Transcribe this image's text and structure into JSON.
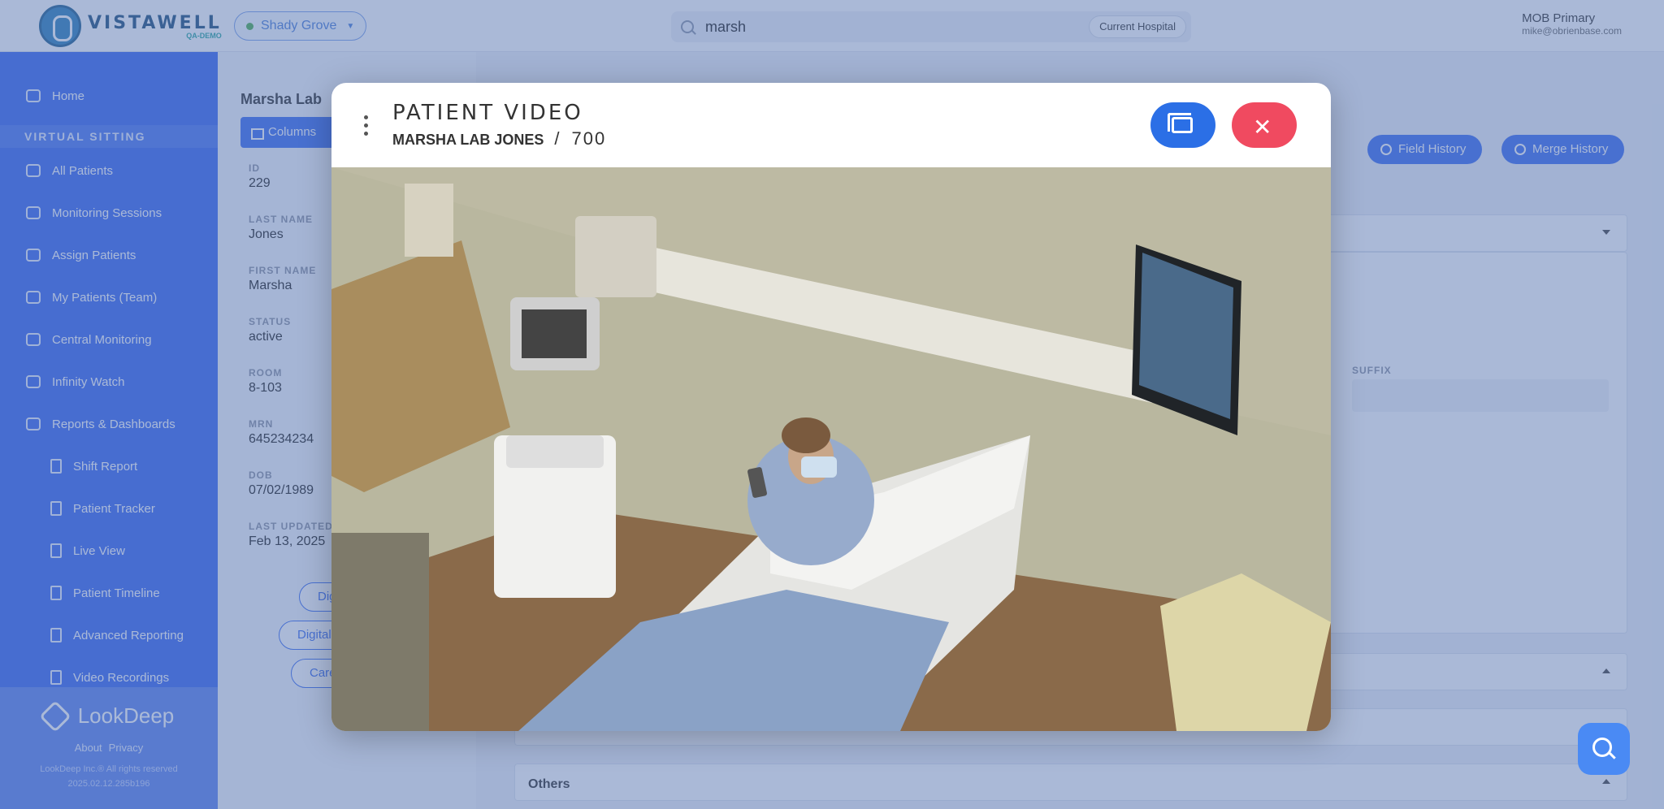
{
  "header": {
    "brand": "VISTAWELL",
    "brand_tag": "QA-DEMO",
    "location": "Shady Grove",
    "search_value": "marsh",
    "search_scope": "Current Hospital",
    "user_name": "MOB Primary",
    "user_email": "mike@obrienbase.com"
  },
  "sidebar": {
    "items": [
      {
        "label": "Home",
        "icon": "home-icon"
      },
      {
        "label": "All Patients",
        "icon": "people-icon"
      },
      {
        "label": "Monitoring Sessions",
        "icon": "broadcast-icon"
      },
      {
        "label": "Assign Patients",
        "icon": "group-icon"
      },
      {
        "label": "My Patients (Team)",
        "icon": "team-icon"
      },
      {
        "label": "Central Monitoring",
        "icon": "dashboard-icon"
      },
      {
        "label": "Infinity Watch",
        "icon": "infinity-icon"
      },
      {
        "label": "Reports & Dashboards",
        "icon": "report-icon"
      },
      {
        "label": "Shift Report",
        "icon": "document-icon"
      },
      {
        "label": "Patient Tracker",
        "icon": "document-icon"
      },
      {
        "label": "Live View",
        "icon": "monitor-icon"
      },
      {
        "label": "Patient Timeline",
        "icon": "timeline-icon"
      },
      {
        "label": "Advanced Reporting",
        "icon": "document-icon"
      },
      {
        "label": "Video Recordings",
        "icon": "document-icon"
      }
    ],
    "section_label": "VIRTUAL SITTING",
    "footer_brand": "LookDeep",
    "footer_about": "About",
    "footer_privacy": "Privacy",
    "footer_copy": "LookDeep Inc.® All rights reserved",
    "footer_version": "2025.02.12.285b196"
  },
  "patient": {
    "title": "Marsha Lab",
    "columns_label": "Columns",
    "fields": [
      {
        "label": "ID",
        "value": "229"
      },
      {
        "label": "LAST NAME",
        "value": "Jones"
      },
      {
        "label": "FIRST NAME",
        "value": "Marsha"
      },
      {
        "label": "STATUS",
        "value": "active"
      },
      {
        "label": "ROOM",
        "value": "8-103"
      },
      {
        "label": "MRN",
        "value": "645234234"
      },
      {
        "label": "DOB",
        "value": "07/02/1989"
      },
      {
        "label": "LAST UPDATED",
        "value": "Feb 13, 2025"
      }
    ],
    "chips": [
      "Dig",
      "Digital",
      "Care"
    ]
  },
  "right": {
    "field_history": "Field History",
    "merge_history": "Merge History",
    "suffix_label": "SUFFIX",
    "others_label": "Others"
  },
  "modal": {
    "title": "PATIENT VIDEO",
    "patient_name": "MARSHA LAB JONES",
    "separator": "/",
    "room": "700",
    "close_symbol": "✕"
  }
}
